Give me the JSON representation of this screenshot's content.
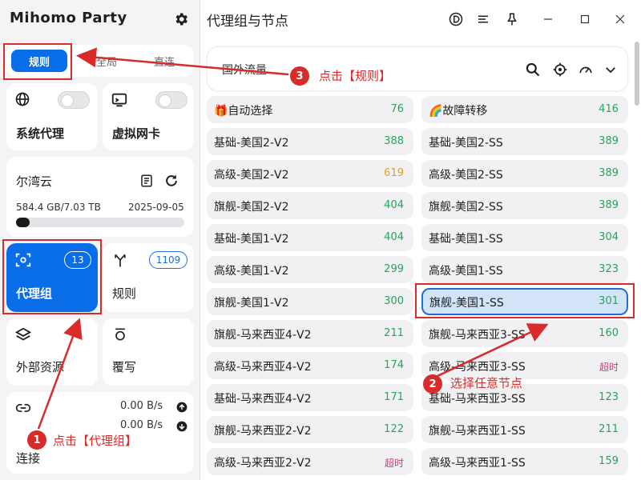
{
  "app": {
    "logo": "Mihomo Party",
    "title": "代理组与节点"
  },
  "mode_tabs": [
    "规则",
    "全局",
    "直连"
  ],
  "sidebar": {
    "system_proxy": "系统代理",
    "tun": "虚拟网卡",
    "profile": {
      "name": "尔湾云",
      "usage": "584.4 GB/7.03 TB",
      "expire": "2025-09-05",
      "progress_percent": 8
    },
    "proxy_groups": {
      "label": "代理组",
      "count": "13"
    },
    "rules": {
      "label": "规则",
      "count": "1109"
    },
    "resources": "外部资源",
    "override": "覆写",
    "connections": {
      "label": "连接",
      "upload": "0.00 B/s",
      "download": "0.00 B/s"
    }
  },
  "group": {
    "name": "国外流量"
  },
  "nodes_left": [
    {
      "name": "🎁自动选择",
      "delay": "76",
      "status": "ok"
    },
    {
      "name": "基础-美国2-V2",
      "delay": "388",
      "status": "ok"
    },
    {
      "name": "高级-美国2-V2",
      "delay": "619",
      "status": "slow"
    },
    {
      "name": "旗舰-美国2-V2",
      "delay": "404",
      "status": "ok"
    },
    {
      "name": "基础-美国1-V2",
      "delay": "404",
      "status": "ok"
    },
    {
      "name": "高级-美国1-V2",
      "delay": "299",
      "status": "ok"
    },
    {
      "name": "旗舰-美国1-V2",
      "delay": "300",
      "status": "ok"
    },
    {
      "name": "旗舰-马来西亚4-V2",
      "delay": "211",
      "status": "ok"
    },
    {
      "name": "高级-马来西亚4-V2",
      "delay": "174",
      "status": "ok"
    },
    {
      "name": "基础-马来西亚4-V2",
      "delay": "171",
      "status": "ok"
    },
    {
      "name": "旗舰-马来西亚2-V2",
      "delay": "122",
      "status": "ok"
    },
    {
      "name": "高级-马来西亚2-V2",
      "delay": "超时",
      "status": "timeout"
    }
  ],
  "nodes_right": [
    {
      "name": "🌈故障转移",
      "delay": "416",
      "status": "ok"
    },
    {
      "name": "基础-美国2-SS",
      "delay": "389",
      "status": "ok"
    },
    {
      "name": "高级-美国2-SS",
      "delay": "389",
      "status": "ok"
    },
    {
      "name": "旗舰-美国2-SS",
      "delay": "389",
      "status": "ok"
    },
    {
      "name": "基础-美国1-SS",
      "delay": "304",
      "status": "ok"
    },
    {
      "name": "高级-美国1-SS",
      "delay": "323",
      "status": "ok"
    },
    {
      "name": "旗舰-美国1-SS",
      "delay": "301",
      "status": "selected"
    },
    {
      "name": "旗舰-马来西亚3-SS",
      "delay": "160",
      "status": "ok"
    },
    {
      "name": "高级-马来西亚3-SS",
      "delay": "超时",
      "status": "timeout"
    },
    {
      "name": "基础-马来西亚3-SS",
      "delay": "123",
      "status": "ok"
    },
    {
      "name": "旗舰-马来西亚1-SS",
      "delay": "211",
      "status": "ok"
    },
    {
      "name": "高级-马来西亚1-SS",
      "delay": "159",
      "status": "ok"
    }
  ],
  "annotations": {
    "step1": {
      "num": "1",
      "text": "点击【代理组】"
    },
    "step2": {
      "num": "2",
      "text": "选择任意节点"
    },
    "step3": {
      "num": "3",
      "text": "点击【规则】"
    }
  },
  "colors": {
    "accent": "#0a6de8",
    "delay_ok": "#20a85a",
    "delay_slow": "#e3a21b",
    "delay_timeout": "#e0317a",
    "annotation": "#d92b2b"
  },
  "icons": [
    "settings-gear-icon",
    "globe-icon",
    "network-card-icon",
    "document-icon",
    "refresh-icon",
    "proxy-groups-icon",
    "rules-icon",
    "layers-icon",
    "override-icon",
    "link-icon",
    "upload-arrow-icon",
    "download-arrow-icon",
    "search-icon",
    "locate-icon",
    "speedtest-icon",
    "chevron-down-icon"
  ]
}
